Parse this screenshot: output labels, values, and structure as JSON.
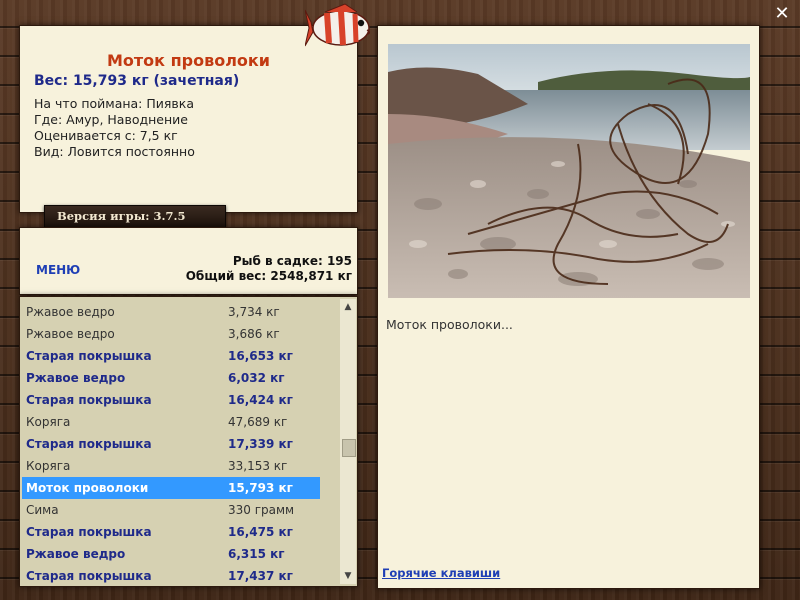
{
  "fish_card": {
    "title": "Моток проволоки",
    "weight": "Вес: 15,793 кг (зачетная)",
    "details": [
      "На что поймана: Пиявка",
      "Где: Амур, Наводнение",
      "Оценивается с: 7,5 кг",
      "Вид: Ловится постоянно"
    ]
  },
  "version": "Версия игры: 3.7.5",
  "stats": {
    "menu_label": "МЕНЮ",
    "fish_count": "Рыб в садке: 195",
    "total_weight": "Общий вес: 2548,871 кг"
  },
  "catch_list": [
    {
      "name": "Ржавое ведро",
      "weight": "3,734 кг",
      "style": "plain"
    },
    {
      "name": "Ржавое ведро",
      "weight": "3,686 кг",
      "style": "plain"
    },
    {
      "name": "Старая покрышка",
      "weight": "16,653 кг",
      "style": "bold"
    },
    {
      "name": "Ржавое ведро",
      "weight": "6,032 кг",
      "style": "bold"
    },
    {
      "name": "Старая покрышка",
      "weight": "16,424 кг",
      "style": "bold"
    },
    {
      "name": "Коряга",
      "weight": "47,689 кг",
      "style": "plain"
    },
    {
      "name": "Старая покрышка",
      "weight": "17,339 кг",
      "style": "bold"
    },
    {
      "name": "Коряга",
      "weight": "33,153 кг",
      "style": "plain"
    },
    {
      "name": "Моток проволоки",
      "weight": "15,793 кг",
      "style": "sel"
    },
    {
      "name": "Сима",
      "weight": "330 грамм",
      "style": "plain"
    },
    {
      "name": "Старая покрышка",
      "weight": "16,475 кг",
      "style": "bold"
    },
    {
      "name": "Ржавое ведро",
      "weight": "6,315 кг",
      "style": "bold"
    },
    {
      "name": "Старая покрышка",
      "weight": "17,437 кг",
      "style": "bold"
    }
  ],
  "caption": "Моток проволоки...",
  "hotkeys_label": "Горячие клавиши",
  "icons": {
    "close": "close-icon",
    "fish": "fish-logo-icon",
    "scroll_up": "chevron-up-icon",
    "scroll_down": "chevron-down-icon"
  },
  "colors": {
    "title": "#c23a12",
    "accent_blue": "#1f2a8a",
    "selection": "#3399ff",
    "panel": "#f7f2dc"
  }
}
